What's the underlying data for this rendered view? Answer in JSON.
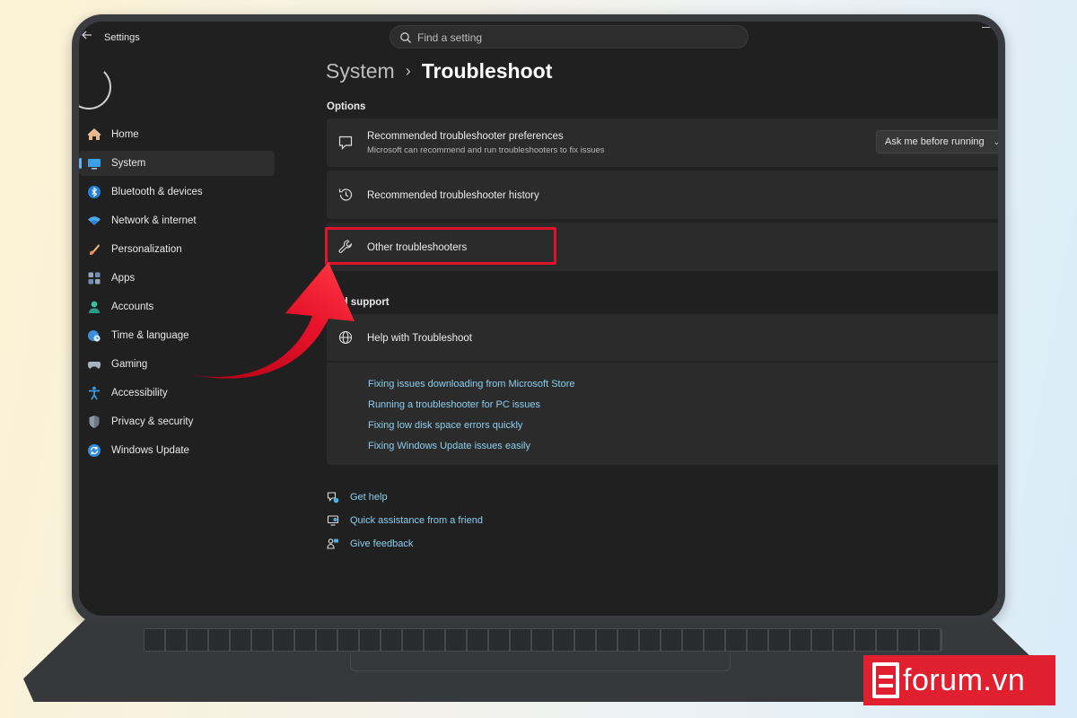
{
  "window": {
    "app_title": "Settings",
    "search_placeholder": "Find a setting"
  },
  "sidebar": {
    "items": [
      {
        "label": "Home",
        "icon": "home-icon",
        "active": false
      },
      {
        "label": "System",
        "icon": "system-icon",
        "active": true
      },
      {
        "label": "Bluetooth & devices",
        "icon": "bluetooth-icon",
        "active": false
      },
      {
        "label": "Network & internet",
        "icon": "wifi-icon",
        "active": false
      },
      {
        "label": "Personalization",
        "icon": "brush-icon",
        "active": false
      },
      {
        "label": "Apps",
        "icon": "apps-icon",
        "active": false
      },
      {
        "label": "Accounts",
        "icon": "account-icon",
        "active": false
      },
      {
        "label": "Time & language",
        "icon": "globe-clock-icon",
        "active": false
      },
      {
        "label": "Gaming",
        "icon": "gamepad-icon",
        "active": false
      },
      {
        "label": "Accessibility",
        "icon": "accessibility-icon",
        "active": false
      },
      {
        "label": "Privacy & security",
        "icon": "shield-icon",
        "active": false
      },
      {
        "label": "Windows Update",
        "icon": "update-icon",
        "active": false
      }
    ]
  },
  "main": {
    "breadcrumb_parent": "System",
    "breadcrumb_separator": "›",
    "breadcrumb_current": "Troubleshoot",
    "options_label": "Options",
    "recommended_prefs": {
      "title": "Recommended troubleshooter preferences",
      "subtitle": "Microsoft can recommend and run troubleshooters to fix issues",
      "dropdown_value": "Ask me before running"
    },
    "recommended_history": {
      "title": "Recommended troubleshooter history"
    },
    "other_troubleshooters": {
      "title": "Other troubleshooters"
    },
    "related_support_label": "ated support",
    "help_card": {
      "title": "Help with Troubleshoot",
      "links": [
        "Fixing issues downloading from Microsoft Store",
        "Running a troubleshooter for PC issues",
        "Fixing low disk space errors quickly",
        "Fixing Windows Update issues easily"
      ]
    },
    "footer_links": [
      {
        "label": "Get help",
        "icon": "help-chat-icon"
      },
      {
        "label": "Quick assistance from a friend",
        "icon": "remote-assist-icon"
      },
      {
        "label": "Give feedback",
        "icon": "feedback-icon"
      }
    ]
  },
  "watermark": {
    "text": "forum.vn",
    "mark": "S"
  },
  "colors": {
    "accent": "#5fb2f2",
    "link": "#8ccfee",
    "highlight": "#e0142d",
    "watermark_bg": "#e01f2f"
  }
}
